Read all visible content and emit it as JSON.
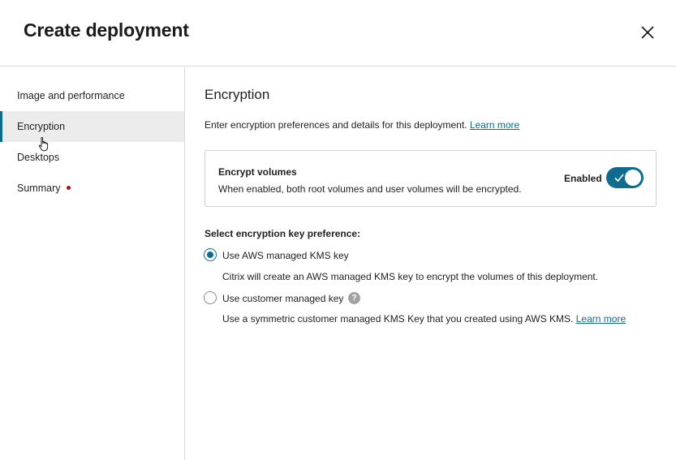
{
  "header": {
    "title": "Create deployment",
    "close_icon": "close-icon"
  },
  "sidebar": {
    "items": [
      {
        "label": "Image and performance",
        "active": false
      },
      {
        "label": "Encryption",
        "active": true
      },
      {
        "label": "Desktops",
        "active": false
      },
      {
        "label": "Summary",
        "active": false,
        "indicator": "red-dot"
      }
    ]
  },
  "main": {
    "title": "Encryption",
    "intro_text": "Enter encryption preferences and details for this deployment.",
    "intro_link": "Learn more",
    "encrypt_card": {
      "title": "Encrypt volumes",
      "description": "When enabled, both root volumes and user volumes will be encrypted.",
      "toggle_label": "Enabled",
      "toggle_on": true
    },
    "key_preference": {
      "label": "Select encryption key preference:",
      "options": [
        {
          "label": "Use AWS managed KMS key",
          "description": "Citrix will create an AWS managed KMS key to encrypt the volumes of this deployment.",
          "selected": true
        },
        {
          "label": "Use customer managed key",
          "help": "?",
          "description": "Use a symmetric customer managed KMS Key that you created using AWS KMS.",
          "link": "Learn more",
          "selected": false
        }
      ]
    }
  },
  "colors": {
    "accent": "#0e6c8f",
    "indicator_red": "#b0121b",
    "border": "#d9d9d9"
  }
}
